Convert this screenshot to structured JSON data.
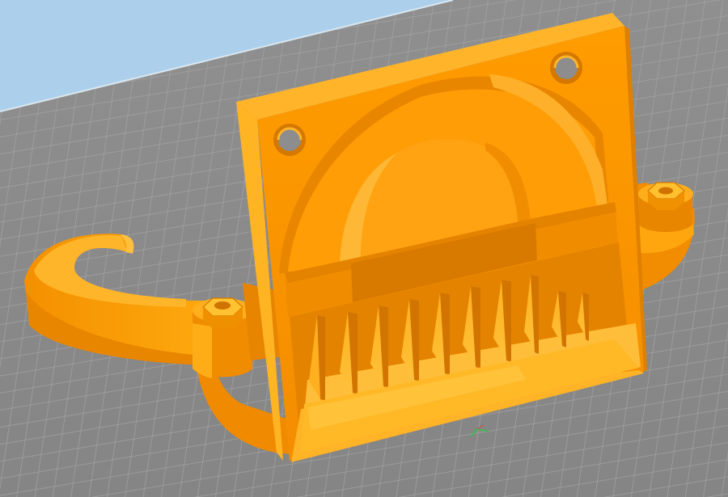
{
  "viewport": {
    "kind": "3d-slicer-preview",
    "colors": {
      "background_sky": "#aecfe9",
      "bed_plate": "#8d8d8d",
      "bed_grid": "#a9a9a9",
      "model_base": "#ff9a00",
      "model_light": "#ffb21a",
      "model_dark": "#e07e00",
      "model_shadow": "#c86c00",
      "axis_x": "#e23c3c",
      "axis_y": "#33c04a"
    },
    "icons": [
      "origin-axis-icon"
    ]
  }
}
